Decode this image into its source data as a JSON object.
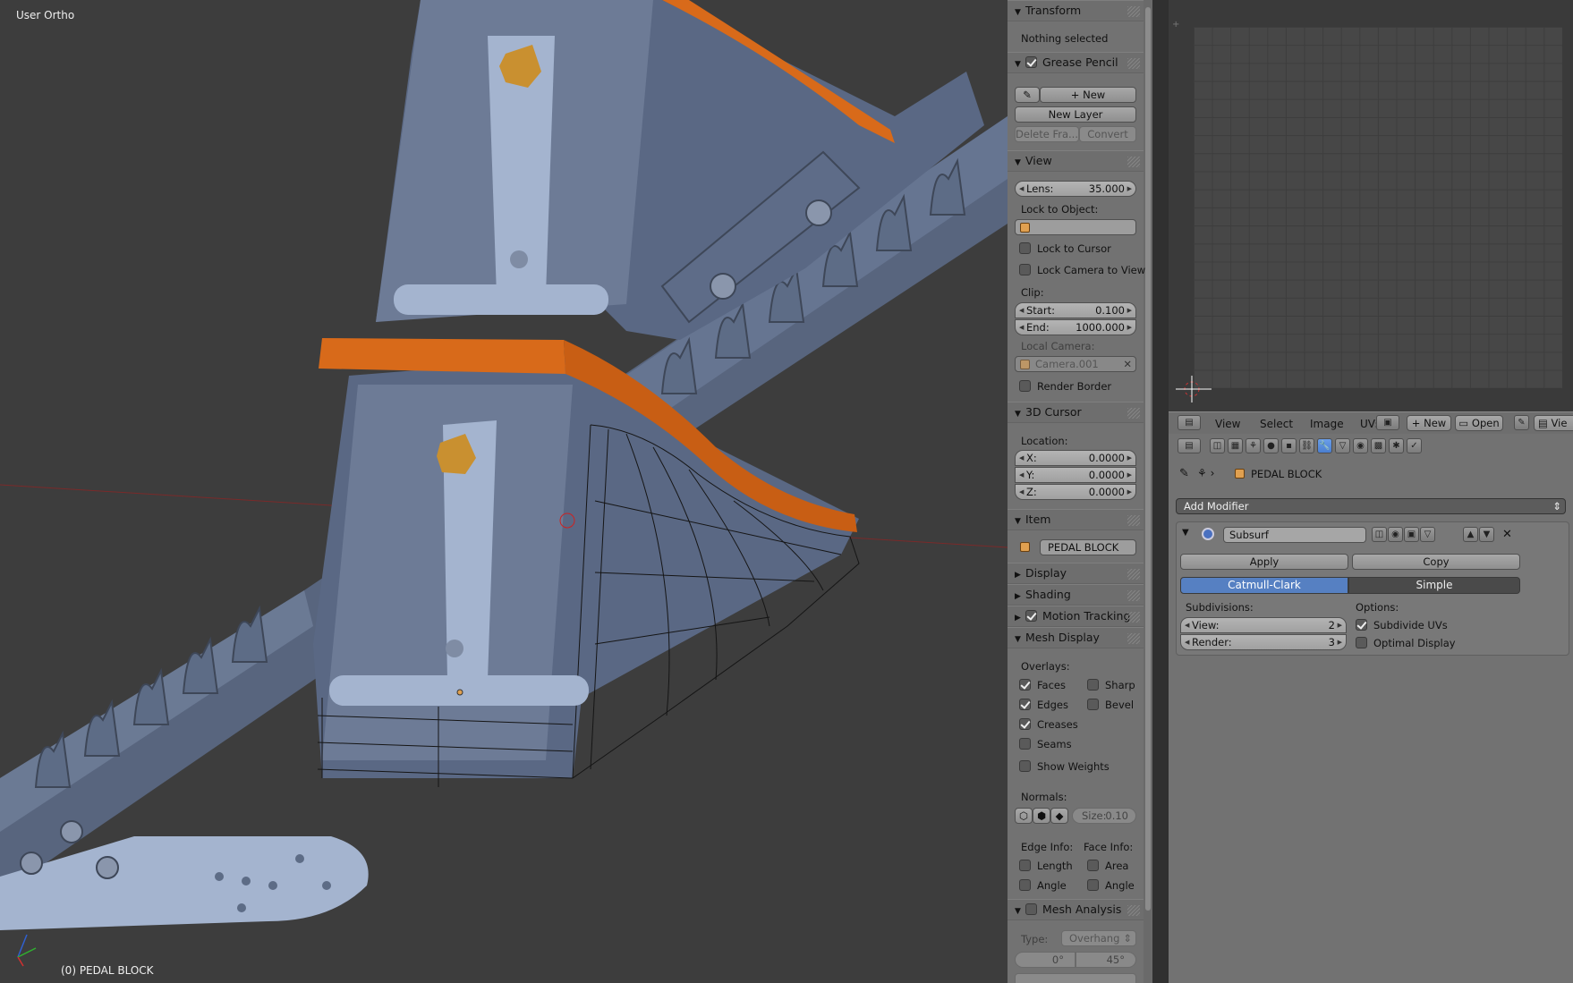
{
  "viewport": {
    "view_label": "User Ortho",
    "object_label": "(0) PEDAL BLOCK"
  },
  "npanel": {
    "transform": {
      "title": "Transform",
      "status": "Nothing selected"
    },
    "grease_pencil": {
      "title": "Grease Pencil",
      "enabled": true,
      "new_label": "New",
      "new_layer_label": "New Layer",
      "delete_frame_label": "Delete Fra...",
      "convert_label": "Convert"
    },
    "view": {
      "title": "View",
      "lens_label": "Lens:",
      "lens_value": "35.000",
      "lock_to_object_label": "Lock to Object:",
      "lock_to_cursor": "Lock to Cursor",
      "lock_camera": "Lock Camera to View",
      "clip_label": "Clip:",
      "start_label": "Start:",
      "start_value": "0.100",
      "end_label": "End:",
      "end_value": "1000.000",
      "local_camera_label": "Local Camera:",
      "local_camera_value": "Camera.001",
      "render_border": "Render Border"
    },
    "cursor": {
      "title": "3D Cursor",
      "location_label": "Location:",
      "x_label": "X:",
      "x_value": "0.0000",
      "y_label": "Y:",
      "y_value": "0.0000",
      "z_label": "Z:",
      "z_value": "0.0000"
    },
    "item": {
      "title": "Item",
      "name": "PEDAL BLOCK"
    },
    "display": {
      "title": "Display"
    },
    "shading": {
      "title": "Shading"
    },
    "motion_tracking": {
      "title": "Motion Tracking",
      "enabled": true
    },
    "mesh_display": {
      "title": "Mesh Display",
      "overlays_label": "Overlays:",
      "faces": "Faces",
      "sharp": "Sharp",
      "edges": "Edges",
      "bevel": "Bevel",
      "creases": "Creases",
      "seams": "Seams",
      "show_weights": "Show Weights",
      "normals_label": "Normals:",
      "size_label": "Size:",
      "size_value": "0.10",
      "edge_info_label": "Edge Info:",
      "face_info_label": "Face Info:",
      "length": "Length",
      "area": "Area",
      "angle_edge": "Angle",
      "angle_face": "Angle"
    },
    "mesh_analysis": {
      "title": "Mesh Analysis",
      "type_label": "Type:",
      "type_value": "Overhang",
      "min_value": "0°",
      "max_value": "45°"
    }
  },
  "uv_header": {
    "menus": [
      "View",
      "Select",
      "Image",
      "UVs"
    ],
    "new_label": "New",
    "open_label": "Open",
    "view_label": "Vie"
  },
  "properties": {
    "object_name": "PEDAL BLOCK",
    "add_modifier": "Add Modifier",
    "modifier_name": "Subsurf",
    "apply_label": "Apply",
    "copy_label": "Copy",
    "catmull_label": "Catmull-Clark",
    "simple_label": "Simple",
    "subdivisions_label": "Subdivisions:",
    "options_label": "Options:",
    "view_label": "View:",
    "view_value": "2",
    "render_label": "Render:",
    "render_value": "3",
    "subdivide_uvs": "Subdivide UVs",
    "optimal_display": "Optimal Display"
  },
  "colors": {
    "selected_blue": "#5680c2",
    "object_orange": "#e0a050",
    "model_blue": "#5d6c86",
    "edge_orange": "#d86a1a"
  }
}
